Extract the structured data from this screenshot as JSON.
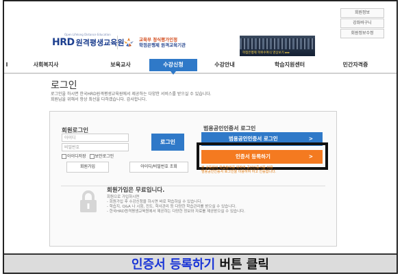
{
  "top_links": [
    "회원정보",
    "강좌바구니",
    "회원정보수정"
  ],
  "logo": {
    "prefix": "HRD",
    "name": "원격평생교육원",
    "tagline": "Open Lifelong Distance Education"
  },
  "certification": {
    "line1": "교육부 정식평가인정",
    "line2": "학점은행제 원격교육기관"
  },
  "banner": {
    "text": "학점은행제 학위수여식 영상보기 ▸▸▸"
  },
  "nav": {
    "items": [
      {
        "label": "I",
        "active": false
      },
      {
        "label": "사회복지사",
        "active": false
      },
      {
        "label": "보육교사",
        "active": false
      },
      {
        "label": "수강신청",
        "active": true
      },
      {
        "label": "수강안내",
        "active": false
      },
      {
        "label": "학습지원센터",
        "active": false
      },
      {
        "label": "민간자격증",
        "active": false
      }
    ]
  },
  "page": {
    "title": "로그인",
    "desc_line1": "로그인을 하시면 한국HRD원격평생교육원에서 제공하는 다양한 서비스를 받으실 수 있습니다.",
    "desc_line2": "회원님을 위해서 항상 최선을 다하겠습니다. 감사합니다."
  },
  "member_login": {
    "title": "회원로그인",
    "id_placeholder": "아이디",
    "pw_placeholder": "비밀번호",
    "login_button": "로그인",
    "save_id": "아이디저장",
    "secure_login": "보안로그인",
    "join_button": "회원가입",
    "find_button": "아이디/비밀번호 조회"
  },
  "cert_login": {
    "title": "범용공인인증서 로그인",
    "login_button": "범용공인인증서 로그인",
    "register_button": "인증서 등록하기",
    "arrow": ">",
    "note_line1": "본 교육원의 학습참여를 위하여 공인인증서를 이용",
    "note_line2": "범용공인인증서 로그인을 이용하여 하고 인증합니다."
  },
  "free_join": {
    "title": "회원가입은 무료입니다.",
    "line1": "회원으로 가입하시면",
    "line2": "- 회원가입 후 수강신청을 하시면 바로 학습하실 수 있습니다.",
    "line3": "- 학습지, Q&A 나 시험, 진도, 학사관리 등 다양한 학습관리를 받으실 수 있습니다.",
    "line4": "- 한국HRD원격평생교육원에서 제공하는 다양한 정보와 자료를 제공받으실 수 있습니다."
  },
  "caption": {
    "highlight": "인증서 등록하기",
    "rest": " 버튼 클릭"
  },
  "colors": {
    "accent_blue": "#2f79c8",
    "register_orange": "#f47a20",
    "caption_blue": "#1a35d6"
  }
}
